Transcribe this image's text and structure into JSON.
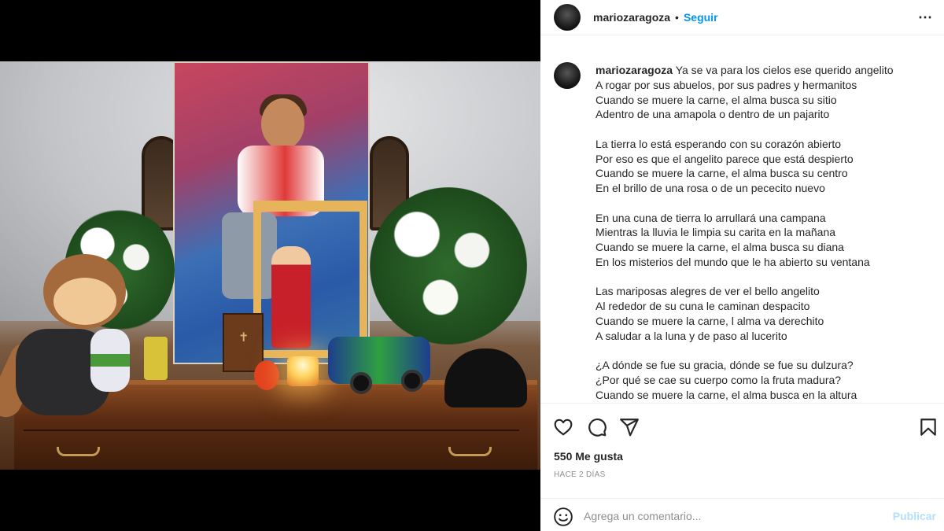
{
  "post": {
    "username": "mariozaragoza",
    "separator": "•",
    "follow_label": "Seguir",
    "more_label": "⋯"
  },
  "caption": {
    "username": "mariozaragoza",
    "first_line": "Ya se va para los cielos ese querido angelito",
    "lines": [
      "A rogar por sus abuelos, por sus padres y hermanitos",
      "Cuando se muere la carne, el alma busca su sitio",
      "Adentro de una amapola o dentro de un pajarito",
      "",
      "La tierra lo está esperando con su corazón abierto",
      "Por eso es que el angelito parece que está despierto",
      "Cuando se muere la carne, el alma busca su centro",
      "En el brillo de una rosa o de un pececito nuevo",
      "",
      "En una cuna de tierra lo arrullará una campana",
      "Mientras la lluvia le limpia su carita en la mañana",
      "Cuando se muere la carne, el alma busca su diana",
      "En los misterios del mundo que le ha abierto su ventana",
      "",
      "Las mariposas alegres de ver el bello angelito",
      "Al rededor de su cuna le caminan despacito",
      "Cuando se muere la carne, l alma va derechito",
      "A saludar a la luna y de paso al lucerito",
      "",
      "¿A dónde se fue su gracia, dónde se fue su dulzura?",
      "¿Por qué se cae su cuerpo como la fruta madura?",
      "Cuando se muere la carne, el alma busca en la altura"
    ]
  },
  "icons": {
    "like": "heart-icon",
    "comment": "comment-icon",
    "share": "paper-plane-icon",
    "save": "bookmark-icon",
    "emoji": "smiley-icon"
  },
  "stats": {
    "likes": "550 Me gusta",
    "time": "HACE 2 DÍAS"
  },
  "comment_box": {
    "placeholder": "Agrega un comentario...",
    "publish_label": "Publicar"
  },
  "colors": {
    "accent": "#0095f6",
    "publish_disabled": "#b2dffc",
    "muted": "#8e8e8e"
  }
}
